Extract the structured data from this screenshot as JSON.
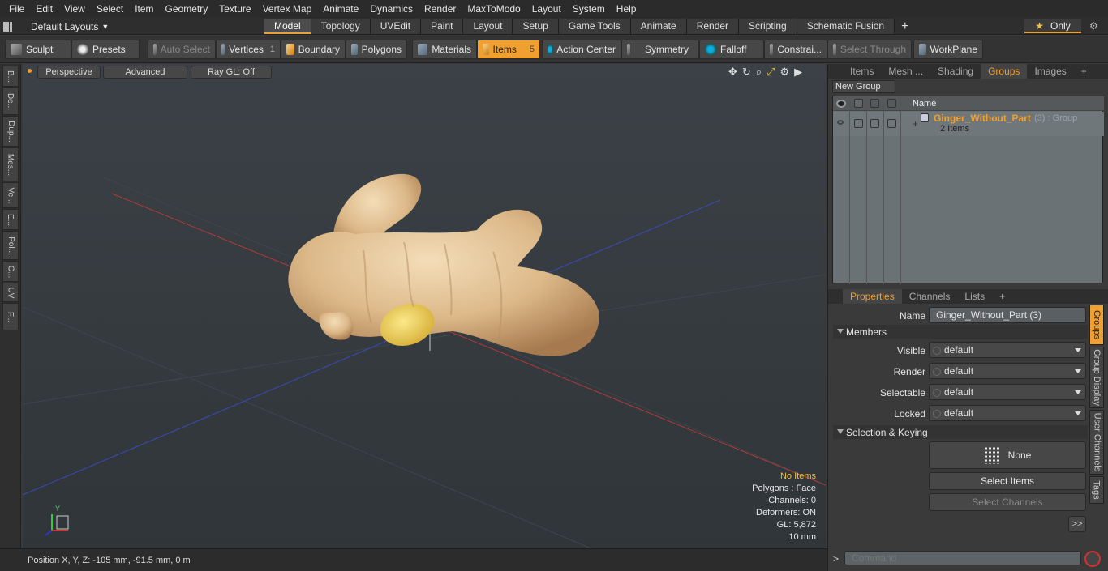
{
  "menu": [
    "File",
    "Edit",
    "View",
    "Select",
    "Item",
    "Geometry",
    "Texture",
    "Vertex Map",
    "Animate",
    "Dynamics",
    "Render",
    "MaxToModo",
    "Layout",
    "System",
    "Help"
  ],
  "layout": {
    "selector": "Default Layouts",
    "tabs": [
      "Model",
      "Topology",
      "UVEdit",
      "Paint",
      "Layout",
      "Setup",
      "Game Tools",
      "Animate",
      "Render",
      "Scripting",
      "Schematic Fusion"
    ],
    "active_tab": "Model",
    "only_label": "Only"
  },
  "toolbar": {
    "sculpt": "Sculpt",
    "presets": "Presets",
    "auto_select": "Auto Select",
    "vertices": "Vertices",
    "vertices_count": "1",
    "boundary": "Boundary",
    "polygons": "Polygons",
    "materials": "Materials",
    "items": "Items",
    "items_count": "5",
    "action_center": "Action Center",
    "symmetry": "Symmetry",
    "falloff": "Falloff",
    "constraints": "Constrai...",
    "select_through": "Select Through",
    "workplane": "WorkPlane"
  },
  "left_tabs": [
    "B...",
    "De...",
    "Dup...",
    "Mes...",
    "Ve...",
    "E...",
    "Pol...",
    "C...",
    "UV",
    "F..."
  ],
  "viewport": {
    "view": "Perspective",
    "shading": "Advanced",
    "raygl": "Ray GL: Off",
    "stats": {
      "no_items": "No Items",
      "polygons": "Polygons : Face",
      "channels": "Channels: 0",
      "deformers": "Deformers: ON",
      "gl": "GL: 5,872",
      "scale": "10 mm"
    },
    "axis_y": "Y"
  },
  "status": {
    "position": "Position X, Y, Z:  -105 mm, -91.5 mm, 0 m"
  },
  "top_panel": {
    "tabs": [
      "Items",
      "Mesh ...",
      "Shading",
      "Groups",
      "Images"
    ],
    "active": "Groups",
    "new_group": "New Group",
    "col_name": "Name",
    "group_name": "Ginger_Without_Part",
    "group_suffix": "(3) : Group",
    "group_items": "2 Items"
  },
  "props": {
    "tabs": [
      "Properties",
      "Channels",
      "Lists"
    ],
    "active": "Properties",
    "name_label": "Name",
    "name_value": "Ginger_Without_Part (3)",
    "members": "Members",
    "visible_label": "Visible",
    "visible_val": "default",
    "render_label": "Render",
    "render_val": "default",
    "selectable_label": "Selectable",
    "selectable_val": "default",
    "locked_label": "Locked",
    "locked_val": "default",
    "sel_keying": "Selection & Keying",
    "none": "None",
    "select_items": "Select Items",
    "select_channels": "Select Channels",
    "more": ">>",
    "side_tabs": [
      "Groups",
      "Group Display",
      "User Channels",
      "Tags"
    ]
  },
  "command": {
    "prompt": ">",
    "placeholder": "Command"
  }
}
